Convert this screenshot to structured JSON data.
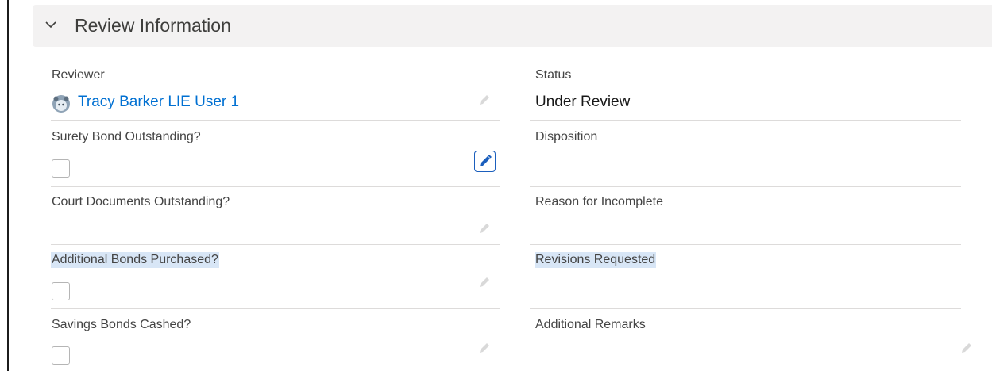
{
  "section": {
    "title": "Review Information",
    "toggle_icon": "chevron-down-icon"
  },
  "left": {
    "reviewer": {
      "label": "Reviewer",
      "value": "Tracy Barker LIE User 1",
      "avatar_icon": "user-avatar-icon"
    },
    "surety_bond": {
      "label": "Surety Bond Outstanding?",
      "checked": false
    },
    "court_documents": {
      "label": "Court Documents Outstanding?",
      "value": ""
    },
    "additional_bonds": {
      "label": "Additional Bonds Purchased?",
      "checked": false
    },
    "savings_bonds": {
      "label": "Savings Bonds Cashed?",
      "checked": false
    }
  },
  "right": {
    "status": {
      "label": "Status",
      "value": "Under Review"
    },
    "disposition": {
      "label": "Disposition",
      "value": ""
    },
    "reason_incomplete": {
      "label": "Reason for Incomplete",
      "value": ""
    },
    "revisions_requested": {
      "label": "Revisions Requested",
      "value": ""
    },
    "additional_remarks": {
      "label": "Additional Remarks",
      "value": ""
    }
  },
  "colors": {
    "link": "#0070d2",
    "header_bg": "#f3f2f2",
    "highlight": "#d8e6f6",
    "active_edit": "#1b5fbd"
  }
}
